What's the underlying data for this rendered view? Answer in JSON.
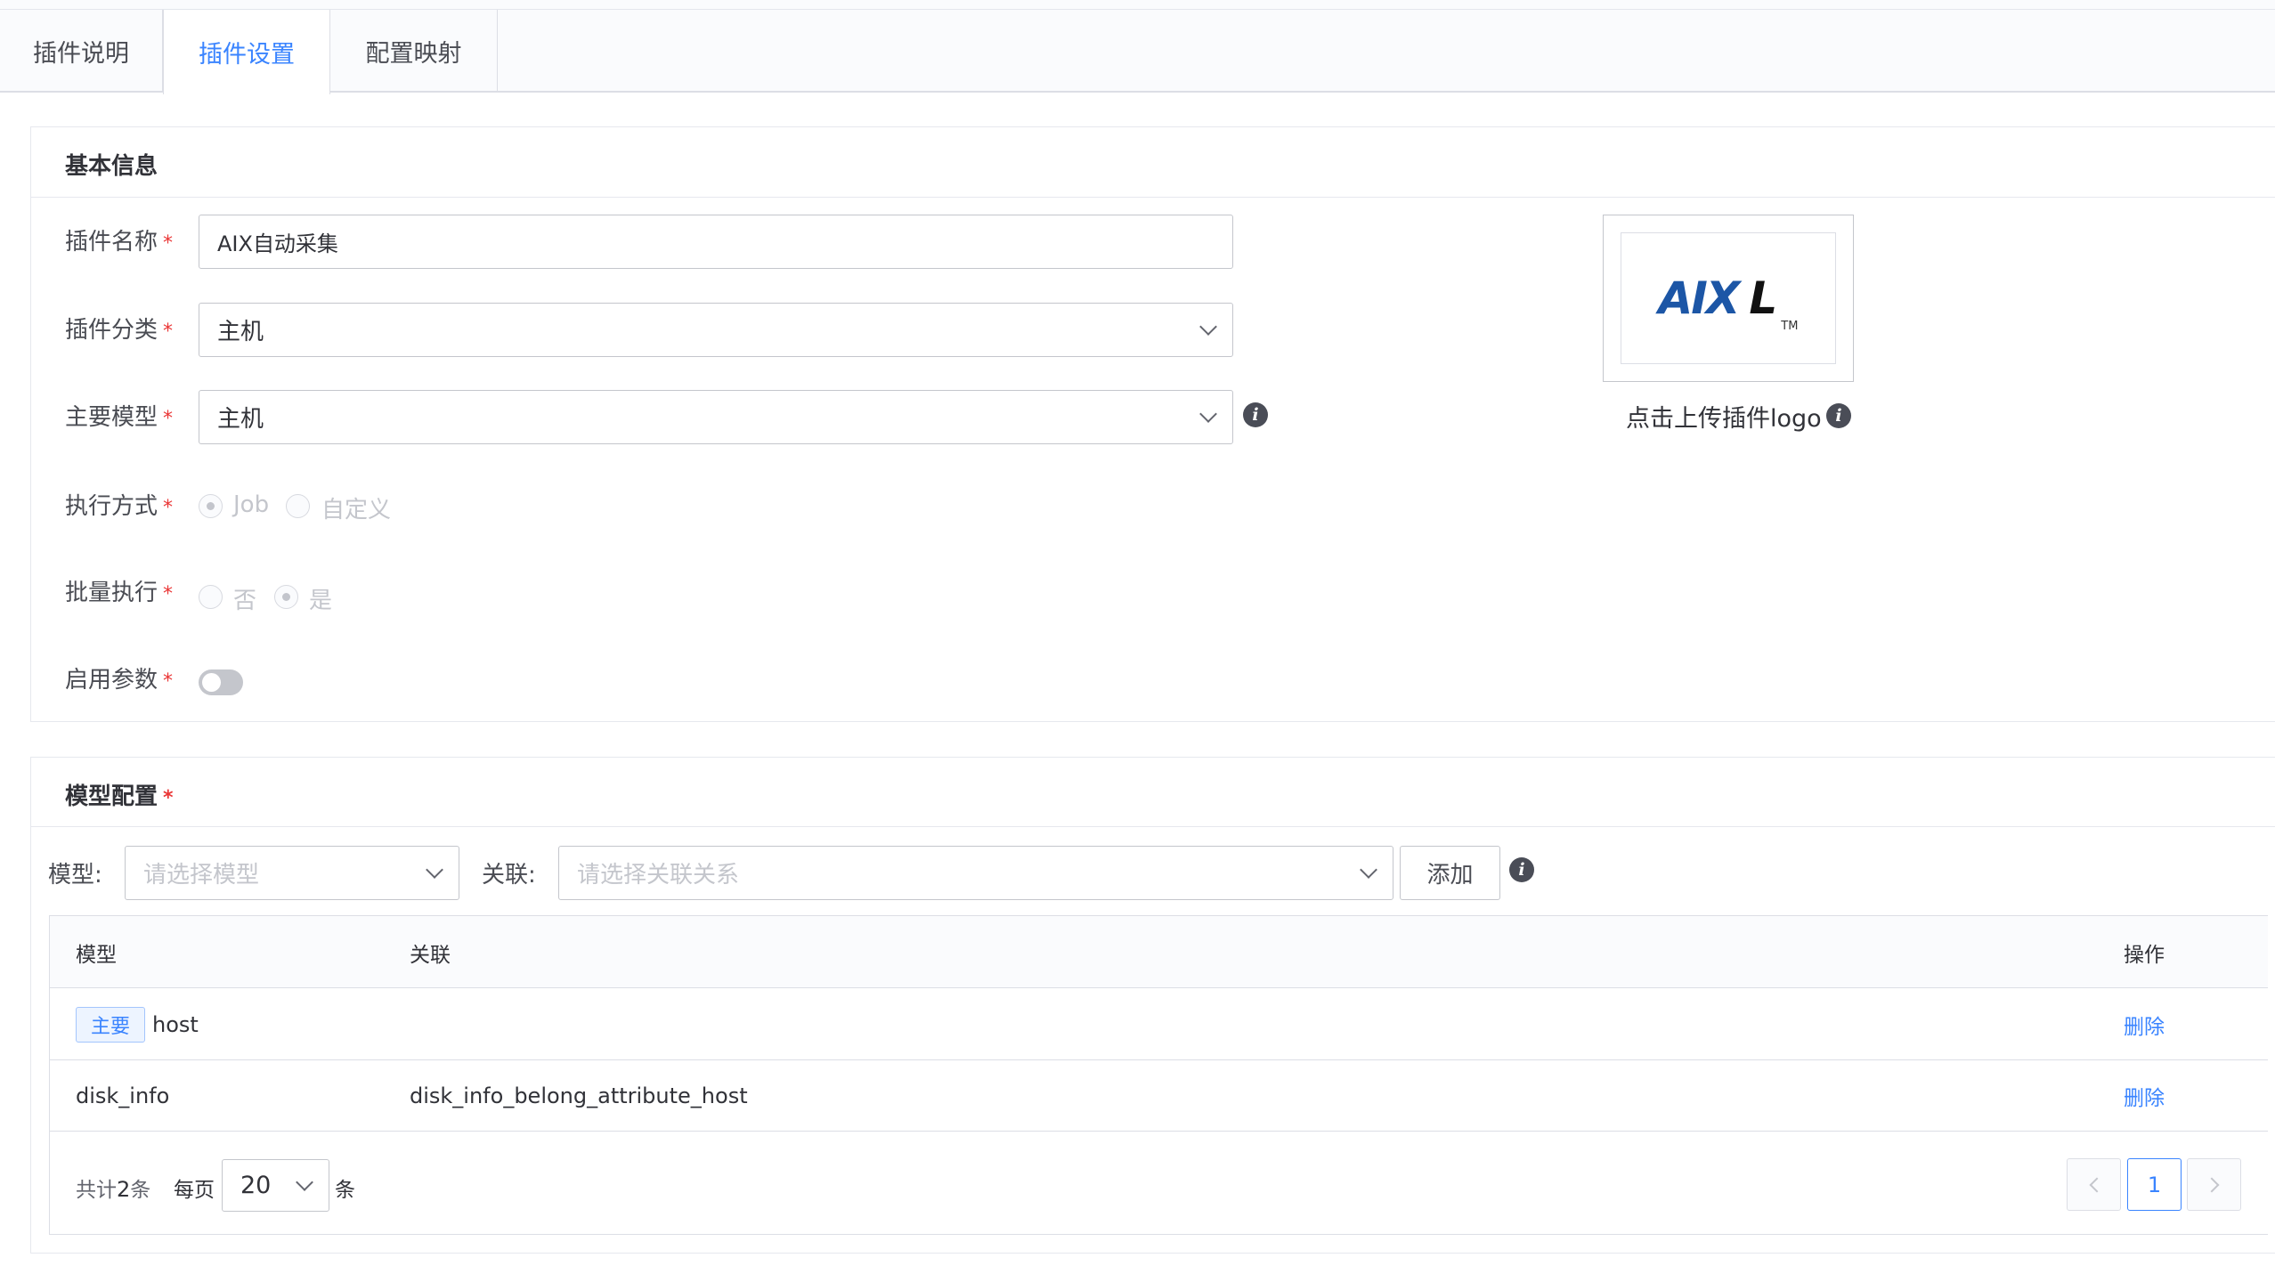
{
  "tabs": [
    "插件说明",
    "插件设置",
    "配置映射"
  ],
  "active_tab": "插件设置",
  "basic": {
    "title": "基本信息",
    "labels": {
      "name": "插件名称",
      "category": "插件分类",
      "model": "主要模型",
      "exec_mode": "执行方式",
      "batch": "批量执行",
      "enable_params": "启用参数"
    },
    "required_mark": "*",
    "name_value": "AIX自动采集",
    "category_value": "主机",
    "model_value": "主机",
    "exec_options": [
      "Job",
      "自定义"
    ],
    "exec_selected": "Job",
    "batch_options": [
      "否",
      "是"
    ],
    "batch_selected": "是",
    "enable_params_on": false,
    "logo": {
      "text_main": "AIX",
      "text_suffix": "L",
      "tm": "TM",
      "upload_label": "点击上传插件logo"
    }
  },
  "model_config": {
    "title": "模型配置",
    "model_label": "模型:",
    "model_placeholder": "请选择模型",
    "relation_label": "关联:",
    "relation_placeholder": "请选择关联关系",
    "add_button": "添加",
    "table": {
      "columns": [
        "模型",
        "关联",
        "操作"
      ],
      "rows": [
        {
          "tag": "主要",
          "model": "host",
          "relation": "",
          "action": "删除"
        },
        {
          "tag": "",
          "model": "disk_info",
          "relation": "disk_info_belong_attribute_host",
          "action": "删除"
        }
      ]
    },
    "pagination": {
      "total_prefix": "共计",
      "total": "2",
      "total_suffix": "条",
      "per_page_label": "每页",
      "per_page": "20",
      "per_page_suffix": "条",
      "current_page": "1"
    }
  },
  "colors": {
    "accent": "#3a84ff",
    "required": "#ea3636",
    "logo_blue": "#1c56a6"
  }
}
